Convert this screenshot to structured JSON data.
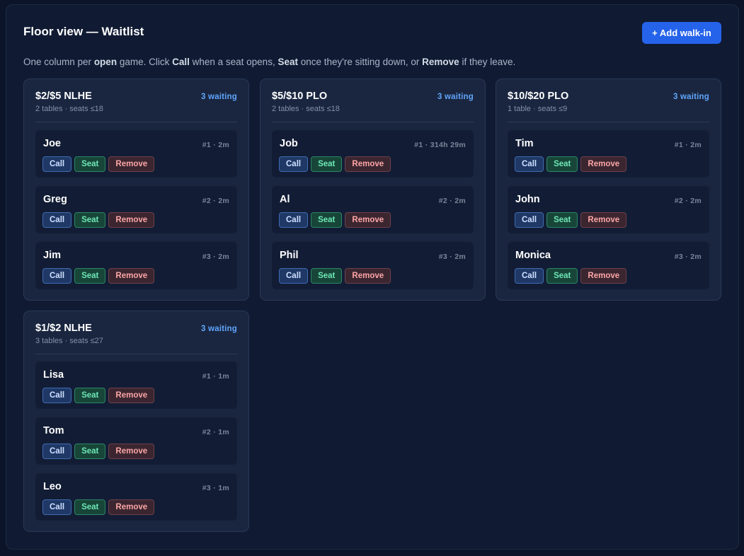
{
  "header": {
    "title": "Floor view — Waitlist",
    "add_button": "+ Add walk-in",
    "subtitle_parts": [
      "One column per ",
      "open",
      " game. Click ",
      "Call",
      " when a seat opens, ",
      "Seat",
      " once they're sitting down, or ",
      "Remove",
      " if they leave."
    ]
  },
  "buttons": {
    "call": "Call",
    "seat": "Seat",
    "remove": "Remove"
  },
  "colors": {
    "accent": "#2563eb",
    "count": "#60a5fa",
    "seat": "#6ee7b7",
    "remove": "#fca5a5"
  },
  "games": [
    {
      "name": "$2/$5 NLHE",
      "meta": "2 tables · seats ≤18",
      "count": "3 waiting",
      "players": [
        {
          "name": "Joe",
          "meta": "#1 · 2m"
        },
        {
          "name": "Greg",
          "meta": "#2 · 2m"
        },
        {
          "name": "Jim",
          "meta": "#3 · 2m"
        }
      ]
    },
    {
      "name": "$5/$10 PLO",
      "meta": "2 tables · seats ≤18",
      "count": "3 waiting",
      "players": [
        {
          "name": "Job",
          "meta": "#1 · 314h 29m"
        },
        {
          "name": "Al",
          "meta": "#2 · 2m"
        },
        {
          "name": "Phil",
          "meta": "#3 · 2m"
        }
      ]
    },
    {
      "name": "$10/$20 PLO",
      "meta": "1 table · seats ≤9",
      "count": "3 waiting",
      "players": [
        {
          "name": "Tim",
          "meta": "#1 · 2m"
        },
        {
          "name": "John",
          "meta": "#2 · 2m"
        },
        {
          "name": "Monica",
          "meta": "#3 · 2m"
        }
      ]
    },
    {
      "name": "$1/$2 NLHE",
      "meta": "3 tables · seats ≤27",
      "count": "3 waiting",
      "players": [
        {
          "name": "Lisa",
          "meta": "#1 · 1m"
        },
        {
          "name": "Tom",
          "meta": "#2 · 1m"
        },
        {
          "name": "Leo",
          "meta": "#3 · 1m"
        }
      ]
    }
  ]
}
